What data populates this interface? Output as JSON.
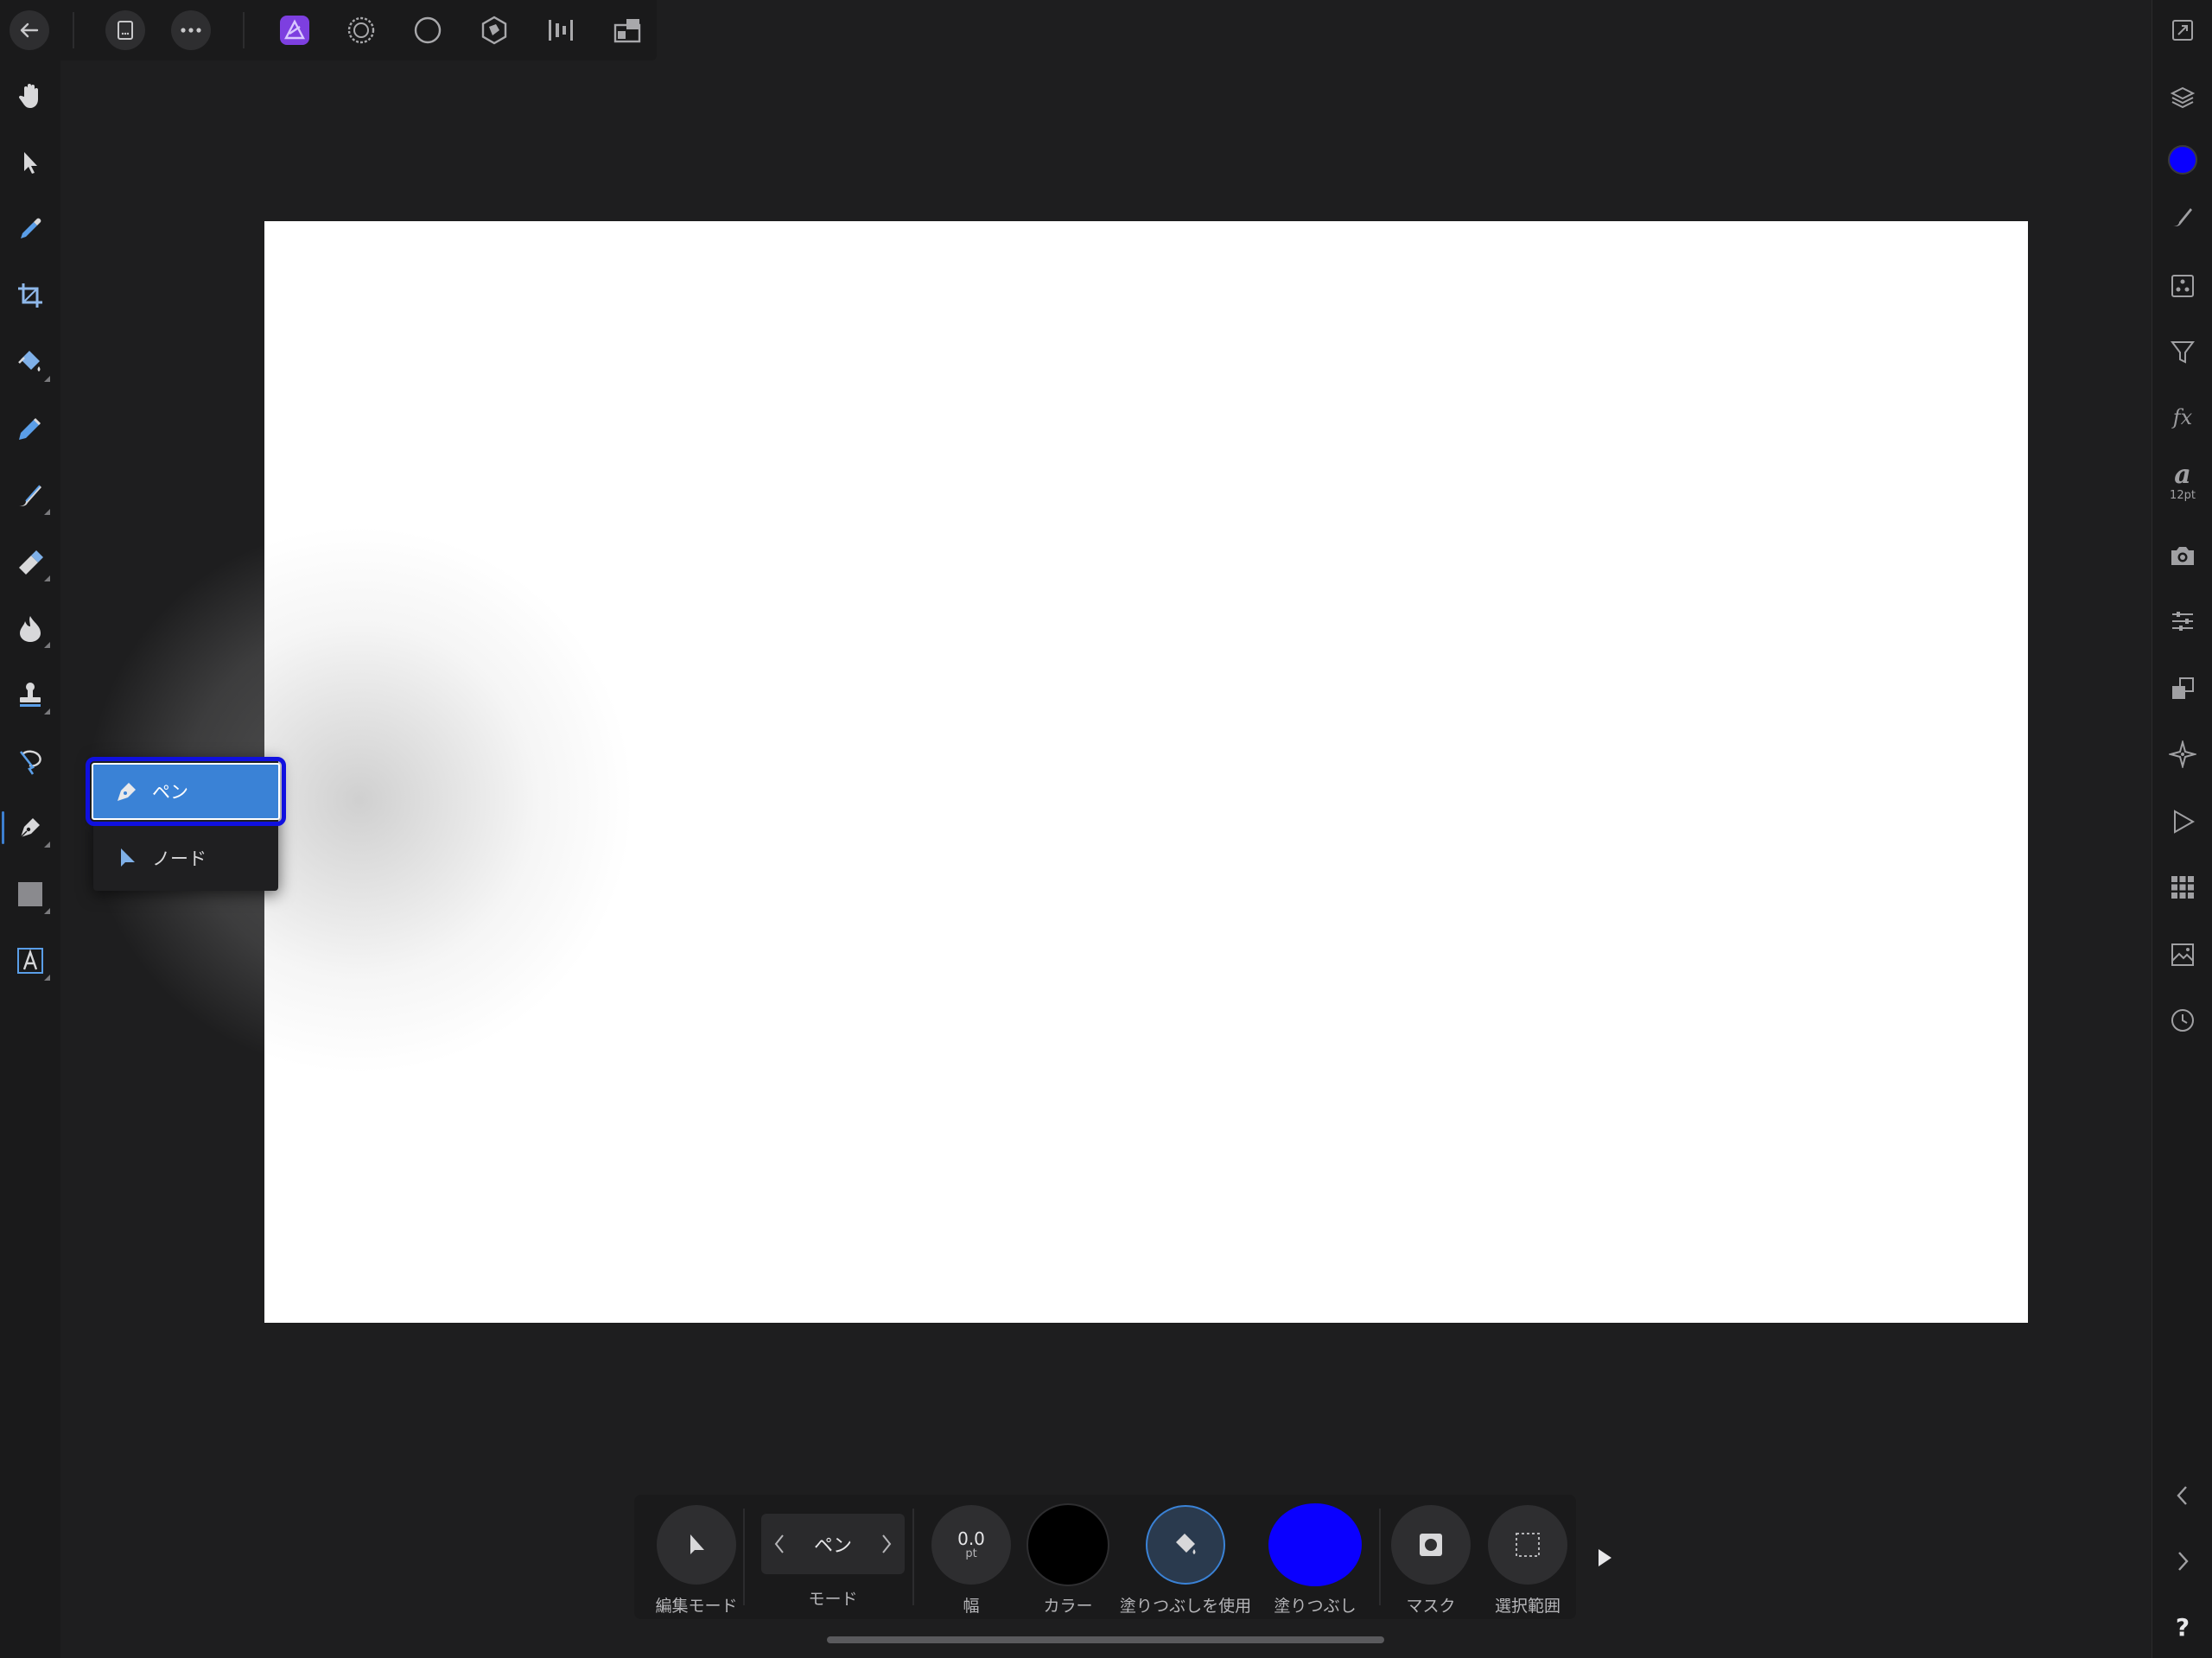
{
  "app": {
    "persona": "Designer",
    "accent": "#3a82d6",
    "fill_color": "#0a00ff",
    "stroke_color": "#000000"
  },
  "top_toolbar": {
    "icons": [
      "back-arrow-icon",
      "document-icon",
      "more-icon",
      "designer-persona-icon",
      "pixel-persona-icon",
      "export-persona-icon",
      "photo-persona-icon",
      "align-icon",
      "arrange-icon"
    ]
  },
  "left_tools": [
    "hand",
    "move",
    "color-picker",
    "crop",
    "fill",
    "pen-tool",
    "brush",
    "eraser",
    "dodge",
    "clone-stamp",
    "lasso",
    "pen-node",
    "rectangle",
    "text"
  ],
  "flyout": {
    "items": [
      {
        "label": "ペン",
        "selected": true
      },
      {
        "label": "ノード",
        "selected": false
      }
    ]
  },
  "right_studio": {
    "font_size_label": "12pt",
    "font_letter": "a",
    "fx_label": "fx"
  },
  "context_toolbar": {
    "edit_mode_label": "編集モード",
    "mode_value": "ペン",
    "mode_label": "モード",
    "width_value": "0.0",
    "width_unit": "pt",
    "width_label": "幅",
    "color_label": "カラー",
    "use_fill_label": "塗りつぶしを使用",
    "fill_label": "塗りつぶし",
    "mask_label": "マスク",
    "selection_label": "選択範囲"
  },
  "help_label": "?"
}
